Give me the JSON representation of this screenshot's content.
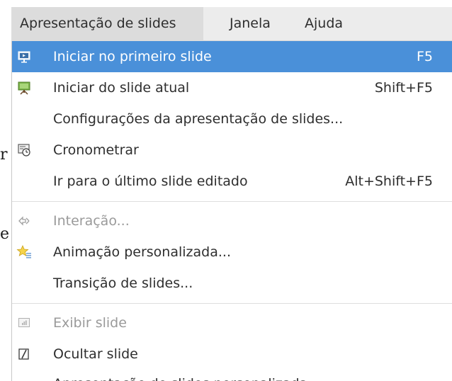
{
  "background": {
    "char_1": "r",
    "char_2": "e"
  },
  "menubar": {
    "items": [
      {
        "label": "Apresentação de slides",
        "active": true
      },
      {
        "label": "Janela"
      },
      {
        "label": "Ajuda"
      }
    ]
  },
  "menu": {
    "highlight_color": "#4a90d9",
    "items": [
      {
        "label": "Iniciar no primeiro slide",
        "shortcut": "F5",
        "icon": "start-presentation-icon",
        "highlighted": true
      },
      {
        "label": "Iniciar do slide atual",
        "shortcut": "Shift+F5",
        "icon": "start-current-slide-icon"
      },
      {
        "label": "Configurações da apresentação de slides...",
        "shortcut": "",
        "icon": ""
      },
      {
        "label": "Cronometrar",
        "shortcut": "",
        "icon": "stopwatch-icon"
      },
      {
        "label": "Ir para o último slide editado",
        "shortcut": "Alt+Shift+F5",
        "icon": ""
      },
      {
        "label": "Interação...",
        "shortcut": "",
        "icon": "interaction-icon",
        "disabled": true
      },
      {
        "label": "Animação personalizada...",
        "shortcut": "",
        "icon": "custom-animation-icon"
      },
      {
        "label": "Transição de slides...",
        "shortcut": "",
        "icon": ""
      },
      {
        "label": "Exibir slide",
        "shortcut": "",
        "icon": "show-slide-icon",
        "disabled": true
      },
      {
        "label": "Ocultar slide",
        "shortcut": "",
        "icon": "hide-slide-icon"
      },
      {
        "label": "Apresentação de slides personalizada...",
        "shortcut": "",
        "icon": ""
      }
    ]
  }
}
